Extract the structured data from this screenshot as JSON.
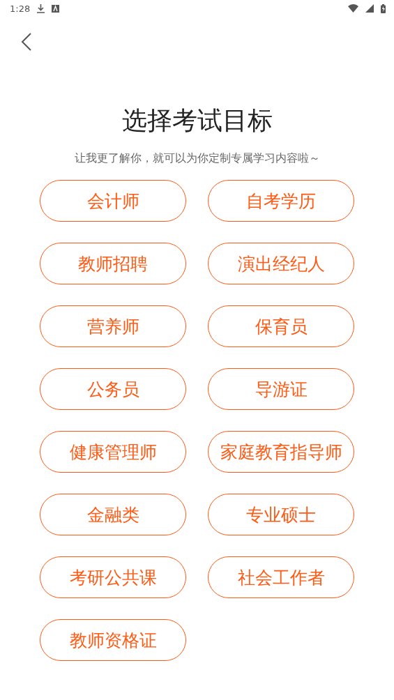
{
  "status_bar": {
    "time": "1:28"
  },
  "title": "选择考试目标",
  "subtitle": "让我更了解你，就可以为你定制专属学习内容啦～",
  "options": [
    "会计师",
    "自考学历",
    "教师招聘",
    "演出经纪人",
    "营养师",
    "保育员",
    "公务员",
    "导游证",
    "健康管理师",
    "家庭教育指导师",
    "金融类",
    "专业硕士",
    "考研公共课",
    "社会工作者",
    "教师资格证"
  ]
}
